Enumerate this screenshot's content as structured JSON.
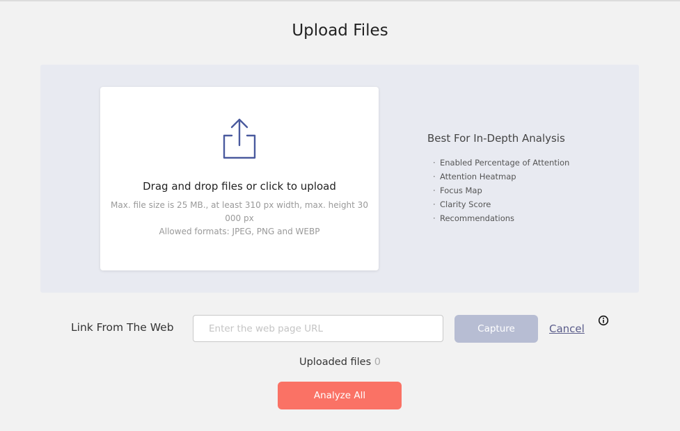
{
  "page": {
    "title": "Upload Files"
  },
  "dropzone": {
    "icon": "upload-share-icon",
    "heading": "Drag and drop files or click to upload",
    "hint": "Max. file size is 25 MB., at least 310 px width, max. height 30 000 px",
    "formats": "Allowed formats: JPEG, PNG and WEBP"
  },
  "features": {
    "title": "Best For In-Depth Analysis",
    "bullet": "·",
    "items": [
      "Enabled Percentage of Attention",
      "Attention Heatmap",
      "Focus Map",
      "Clarity Score",
      "Recommendations"
    ]
  },
  "web_link": {
    "label": "Link From The Web",
    "input_value": "",
    "placeholder": "Enter the web page URL",
    "capture_label": "Capture",
    "cancel_label": "Cancel",
    "info_icon": "info-circle-icon"
  },
  "uploaded": {
    "label": "Uploaded files",
    "count": "0"
  },
  "actions": {
    "analyze_label": "Analyze All"
  },
  "colors": {
    "background": "#f2f2f2",
    "panel": "#e8eaf1",
    "icon_accent": "#4a5a9e",
    "capture_disabled": "#b7bdd3",
    "analyze": "#fa7265",
    "cancel_link": "#5a5c8a"
  }
}
